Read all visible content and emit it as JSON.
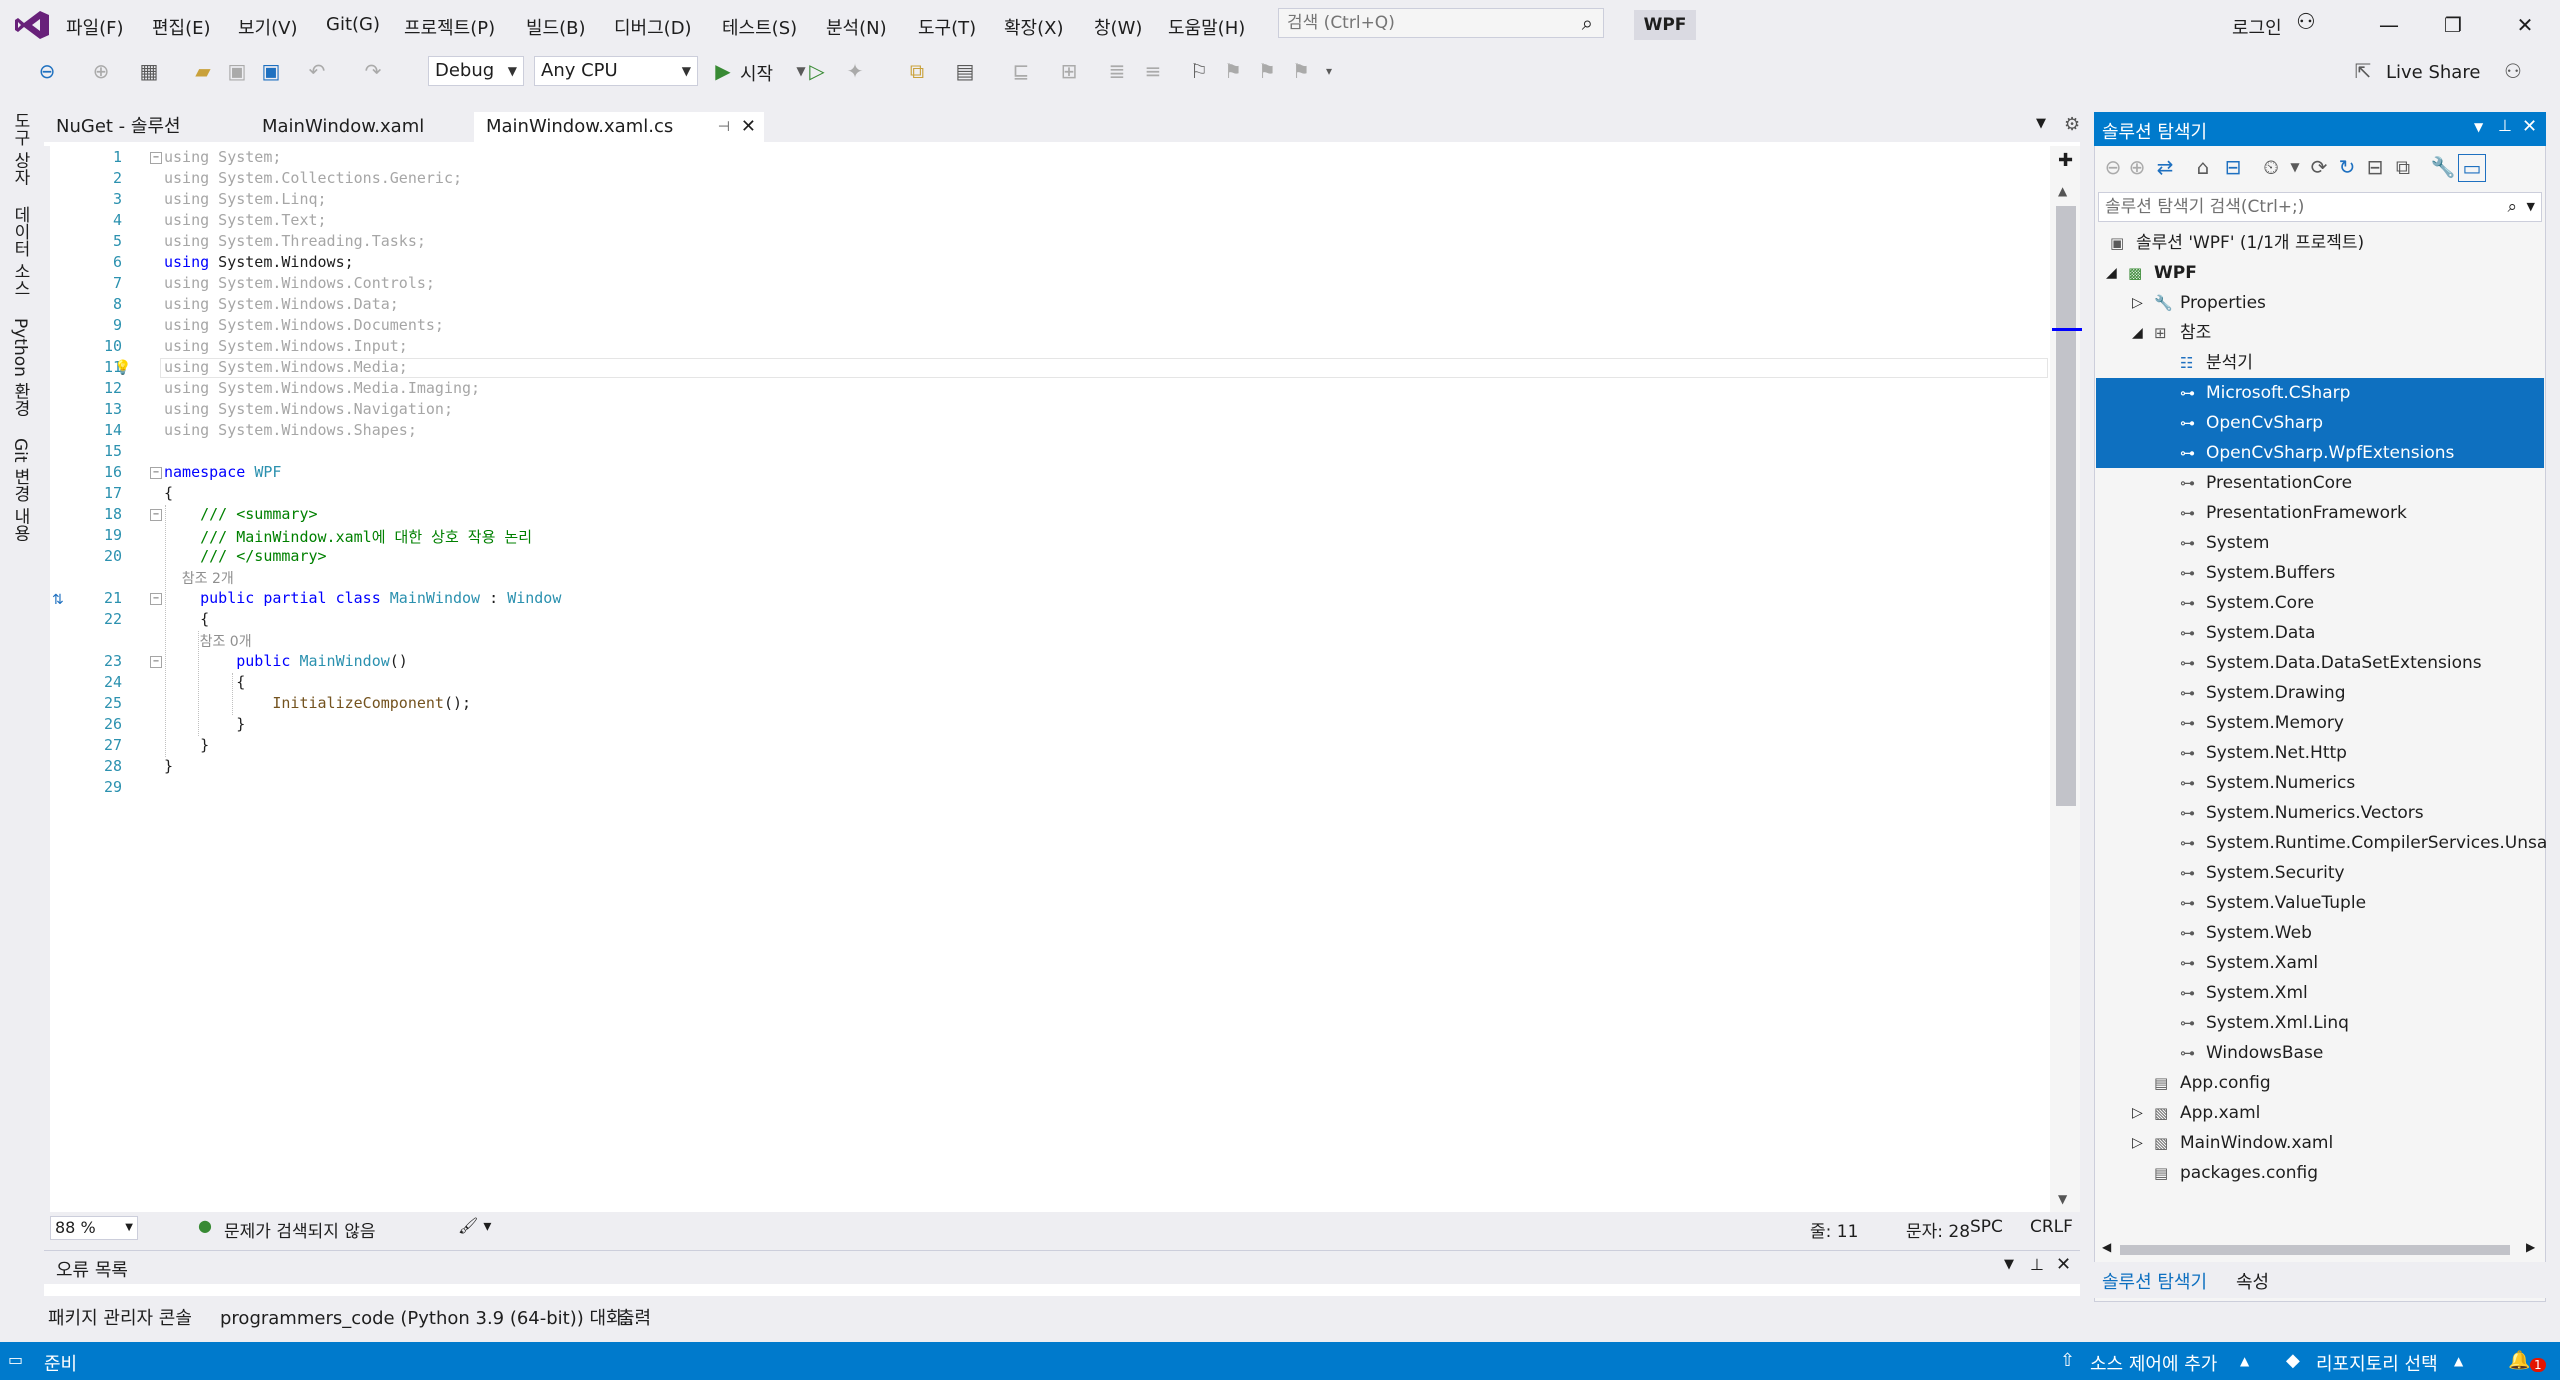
{
  "menu": {
    "items": [
      "파일(F)",
      "편집(E)",
      "보기(V)",
      "Git(G)",
      "프로젝트(P)",
      "빌드(B)",
      "디버그(D)",
      "테스트(S)",
      "분석(N)",
      "도구(T)",
      "확장(X)",
      "창(W)",
      "도움말(H)"
    ],
    "search_placeholder": "검색 (Ctrl+Q)",
    "solution_badge": "WPF",
    "login": "로그인"
  },
  "toolbar": {
    "config": "Debug",
    "platform": "Any CPU",
    "start": "시작",
    "live_share": "Live Share"
  },
  "left_strip": {
    "tabs": [
      "도구 상자",
      "데이터 소스",
      "Python 환경",
      "Git 변경 내용"
    ]
  },
  "tabs": [
    {
      "label": "NuGet - 솔루션",
      "active": false
    },
    {
      "label": "MainWindow.xaml",
      "active": false
    },
    {
      "label": "MainWindow.xaml.cs",
      "active": true
    }
  ],
  "editor": {
    "lines": [
      {
        "n": "1",
        "text": "using System;",
        "style": "faded"
      },
      {
        "n": "2",
        "text": "using System.Collections.Generic;",
        "style": "faded"
      },
      {
        "n": "3",
        "text": "using System.Linq;",
        "style": "faded"
      },
      {
        "n": "4",
        "text": "using System.Text;",
        "style": "faded"
      },
      {
        "n": "5",
        "text": "using System.Threading.Tasks;",
        "style": "faded"
      },
      {
        "n": "6",
        "text": "using System.Windows;",
        "style": "active"
      },
      {
        "n": "7",
        "text": "using System.Windows.Controls;",
        "style": "faded"
      },
      {
        "n": "8",
        "text": "using System.Windows.Data;",
        "style": "faded"
      },
      {
        "n": "9",
        "text": "using System.Windows.Documents;",
        "style": "faded"
      },
      {
        "n": "10",
        "text": "using System.Windows.Input;",
        "style": "faded"
      },
      {
        "n": "11",
        "text": "using System.Windows.Media;",
        "style": "faded"
      },
      {
        "n": "12",
        "text": "using System.Windows.Media.Imaging;",
        "style": "faded"
      },
      {
        "n": "13",
        "text": "using System.Windows.Navigation;",
        "style": "faded"
      },
      {
        "n": "14",
        "text": "using System.Windows.Shapes;",
        "style": "faded"
      },
      {
        "n": "15",
        "text": "",
        "style": "plain"
      },
      {
        "n": "16",
        "text": "namespace WPF",
        "style": "namespace"
      },
      {
        "n": "17",
        "text": "{",
        "style": "plain"
      },
      {
        "n": "18",
        "text": "    /// <summary>",
        "style": "comment"
      },
      {
        "n": "19",
        "text": "    /// MainWindow.xaml에 대한 상호 작용 논리",
        "style": "comment"
      },
      {
        "n": "20",
        "text": "    /// </summary>",
        "style": "comment"
      },
      {
        "n": "",
        "text": "    참조 2개",
        "style": "lens"
      },
      {
        "n": "21",
        "text": "    public partial class MainWindow : Window",
        "style": "classdecl"
      },
      {
        "n": "22",
        "text": "    {",
        "style": "plain"
      },
      {
        "n": "",
        "text": "        참조 0개",
        "style": "lens"
      },
      {
        "n": "23",
        "text": "        public MainWindow()",
        "style": "ctor"
      },
      {
        "n": "24",
        "text": "        {",
        "style": "plain"
      },
      {
        "n": "25",
        "text": "            InitializeComponent();",
        "style": "call"
      },
      {
        "n": "26",
        "text": "        }",
        "style": "plain"
      },
      {
        "n": "27",
        "text": "    }",
        "style": "plain"
      },
      {
        "n": "28",
        "text": "}",
        "style": "plain"
      },
      {
        "n": "29",
        "text": "",
        "style": "plain"
      }
    ]
  },
  "editor_status": {
    "zoom": "88 %",
    "issues": "문제가 검색되지 않음",
    "line": "줄: 11",
    "col": "문자: 28",
    "spc": "SPC",
    "eol": "CRLF"
  },
  "error_list": {
    "title": "오류 목록"
  },
  "bottom_tabs": [
    "패키지 관리자 콘솔",
    "programmers_code (Python 3.9 (64-bit)) 대화...",
    "출력"
  ],
  "solution_explorer": {
    "title": "솔루션 탐색기",
    "search_placeholder": "솔루션 탐색기 검색(Ctrl+;)",
    "tree": [
      {
        "label": "솔루션 'WPF' (1/1개 프로젝트)",
        "level": 0,
        "icon": "solution-icon",
        "expander": "",
        "selected": false
      },
      {
        "label": "WPF",
        "level": 1,
        "icon": "csharp-project-icon",
        "expander": "◢",
        "selected": false,
        "bold": true
      },
      {
        "label": "Properties",
        "level": 2,
        "icon": "wrench-icon",
        "expander": "▷",
        "selected": false
      },
      {
        "label": "참조",
        "level": 2,
        "icon": "references-icon",
        "expander": "◢",
        "selected": false
      },
      {
        "label": "분석기",
        "level": 3,
        "icon": "analyzer-icon",
        "expander": "",
        "selected": false
      },
      {
        "label": "Microsoft.CSharp",
        "level": 3,
        "icon": "reference-icon",
        "expander": "",
        "selected": true
      },
      {
        "label": "OpenCvSharp",
        "level": 3,
        "icon": "reference-icon",
        "expander": "",
        "selected": true
      },
      {
        "label": "OpenCvSharp.WpfExtensions",
        "level": 3,
        "icon": "reference-icon",
        "expander": "",
        "selected": true
      },
      {
        "label": "PresentationCore",
        "level": 3,
        "icon": "reference-icon",
        "expander": "",
        "selected": false
      },
      {
        "label": "PresentationFramework",
        "level": 3,
        "icon": "reference-icon",
        "expander": "",
        "selected": false
      },
      {
        "label": "System",
        "level": 3,
        "icon": "reference-icon",
        "expander": "",
        "selected": false
      },
      {
        "label": "System.Buffers",
        "level": 3,
        "icon": "reference-icon",
        "expander": "",
        "selected": false
      },
      {
        "label": "System.Core",
        "level": 3,
        "icon": "reference-icon",
        "expander": "",
        "selected": false
      },
      {
        "label": "System.Data",
        "level": 3,
        "icon": "reference-icon",
        "expander": "",
        "selected": false
      },
      {
        "label": "System.Data.DataSetExtensions",
        "level": 3,
        "icon": "reference-icon",
        "expander": "",
        "selected": false
      },
      {
        "label": "System.Drawing",
        "level": 3,
        "icon": "reference-icon",
        "expander": "",
        "selected": false
      },
      {
        "label": "System.Memory",
        "level": 3,
        "icon": "reference-icon",
        "expander": "",
        "selected": false
      },
      {
        "label": "System.Net.Http",
        "level": 3,
        "icon": "reference-icon",
        "expander": "",
        "selected": false
      },
      {
        "label": "System.Numerics",
        "level": 3,
        "icon": "reference-icon",
        "expander": "",
        "selected": false
      },
      {
        "label": "System.Numerics.Vectors",
        "level": 3,
        "icon": "reference-icon",
        "expander": "",
        "selected": false
      },
      {
        "label": "System.Runtime.CompilerServices.Unsa",
        "level": 3,
        "icon": "reference-icon",
        "expander": "",
        "selected": false
      },
      {
        "label": "System.Security",
        "level": 3,
        "icon": "reference-icon",
        "expander": "",
        "selected": false
      },
      {
        "label": "System.ValueTuple",
        "level": 3,
        "icon": "reference-icon",
        "expander": "",
        "selected": false
      },
      {
        "label": "System.Web",
        "level": 3,
        "icon": "reference-icon",
        "expander": "",
        "selected": false
      },
      {
        "label": "System.Xaml",
        "level": 3,
        "icon": "reference-icon",
        "expander": "",
        "selected": false
      },
      {
        "label": "System.Xml",
        "level": 3,
        "icon": "reference-icon",
        "expander": "",
        "selected": false
      },
      {
        "label": "System.Xml.Linq",
        "level": 3,
        "icon": "reference-icon",
        "expander": "",
        "selected": false
      },
      {
        "label": "WindowsBase",
        "level": 3,
        "icon": "reference-icon",
        "expander": "",
        "selected": false
      },
      {
        "label": "App.config",
        "level": 2,
        "icon": "config-file-icon",
        "expander": "",
        "selected": false
      },
      {
        "label": "App.xaml",
        "level": 2,
        "icon": "xaml-file-icon",
        "expander": "▷",
        "selected": false
      },
      {
        "label": "MainWindow.xaml",
        "level": 2,
        "icon": "xaml-file-icon",
        "expander": "▷",
        "selected": false
      },
      {
        "label": "packages.config",
        "level": 2,
        "icon": "config-file-icon",
        "expander": "",
        "selected": false
      }
    ],
    "bottom_tabs": [
      "솔루션 탐색기",
      "속성"
    ]
  },
  "statusbar": {
    "ready": "준비",
    "source_control": "소스 제어에 추가",
    "repository": "리포지토리 선택",
    "notifications": "1"
  },
  "colors": {
    "accent": "#007acc",
    "selection": "#0e70c0",
    "keyword": "#0000ff",
    "type": "#2b91af",
    "comment": "#008000"
  }
}
